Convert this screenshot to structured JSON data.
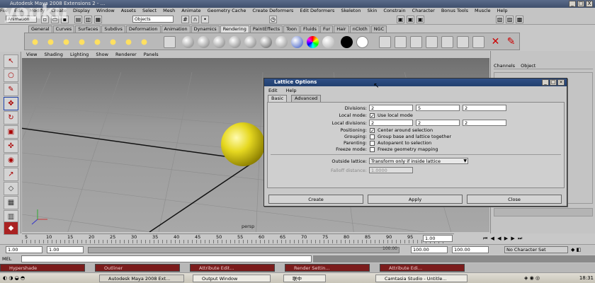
{
  "app": {
    "title": "Autodesk Maya 2008 Extensions 2 - ...",
    "window_controls": [
      "_",
      "□",
      "X"
    ]
  },
  "watermark": {
    "text": "youku",
    "sub": ".com"
  },
  "main_menu": [
    "File",
    "Edit",
    "Modify",
    "Create",
    "Display",
    "Window",
    "Assets",
    "Select",
    "Mesh",
    "Animate",
    "Geometry Cache",
    "Create Deformers",
    "Edit Deformers",
    "Skeleton",
    "Skin",
    "Constrain",
    "Character",
    "Bonus Tools",
    "Muscle",
    "Help"
  ],
  "status_line": {
    "menu_set": "Animation",
    "selection_field": "Objects"
  },
  "shelf_tabs": [
    {
      "label": "General"
    },
    {
      "label": "Curves"
    },
    {
      "label": "Surfaces"
    },
    {
      "label": "Subdivs"
    },
    {
      "label": "Deformation"
    },
    {
      "label": "Animation"
    },
    {
      "label": "Dynamics"
    },
    {
      "label": "Rendering",
      "active": true
    },
    {
      "label": "PaintEffects"
    },
    {
      "label": "Toon"
    },
    {
      "label": "Fluids"
    },
    {
      "label": "Fur"
    },
    {
      "label": "Hair"
    },
    {
      "label": "nCloth"
    },
    {
      "label": "NGC"
    }
  ],
  "panel_menu": [
    "View",
    "Shading",
    "Lighting",
    "Show",
    "Renderer",
    "Panels"
  ],
  "viewport": {
    "camera_label": "persp",
    "sphere_color": "#e6d820",
    "axis": [
      "x",
      "y",
      "z"
    ]
  },
  "channel_box": {
    "tabs": [
      "Channels",
      "Object"
    ]
  },
  "dialog": {
    "title": "Lattice Options",
    "menu": [
      "Edit",
      "Help"
    ],
    "tabs": [
      "Basic",
      "Advanced"
    ],
    "rows": {
      "divisions": {
        "label": "Divisions:",
        "values": [
          "2",
          "5",
          "2"
        ]
      },
      "local_mode": {
        "label": "Local mode:",
        "checkbox": "Use local mode",
        "checked": true
      },
      "local_divisions": {
        "label": "Local divisions:",
        "values": [
          "2",
          "2",
          "2"
        ]
      },
      "positioning": {
        "label": "Positioning:",
        "checkbox": "Center around selection",
        "checked": true
      },
      "grouping": {
        "label": "Grouping:",
        "checkbox": "Group base and lattice together",
        "checked": false
      },
      "parenting": {
        "label": "Parenting:",
        "checkbox": "Autoparent to selection",
        "checked": false
      },
      "freeze_mode": {
        "label": "Freeze mode:",
        "checkbox": "Freeze geometry mapping",
        "checked": false
      },
      "outside_lattice": {
        "label": "Outside lattice:",
        "value": "Transform only if inside lattice"
      },
      "falloff_distance": {
        "label": "Falloff distance:",
        "value": "1.0000"
      }
    },
    "buttons": {
      "create": "Create",
      "apply": "Apply",
      "close": "Close"
    }
  },
  "time_slider": {
    "ticks": [
      "5",
      "10",
      "15",
      "20",
      "25",
      "30",
      "35",
      "40",
      "45",
      "50",
      "55",
      "60",
      "65",
      "70",
      "75",
      "80",
      "85",
      "90",
      "95"
    ],
    "current_frame": "1.00"
  },
  "range_slider": {
    "start": "1.00",
    "playback_start": "1.00",
    "playback_end": "100.00",
    "end_a": "100.00",
    "end_b": "100.00",
    "character_set": "No Character Set"
  },
  "command_line": {
    "label": "MEL"
  },
  "minimized_windows": [
    "Hypershade",
    "Outliner",
    "Attribute Edit...",
    "Render Settin...",
    "Attribute Edi..."
  ],
  "taskbar": {
    "tasks": [
      "Autodesk Maya 2008 Ext...",
      "Output Window",
      "联中",
      "Camtasia Studio - Untitle..."
    ],
    "clock": "18:31"
  }
}
